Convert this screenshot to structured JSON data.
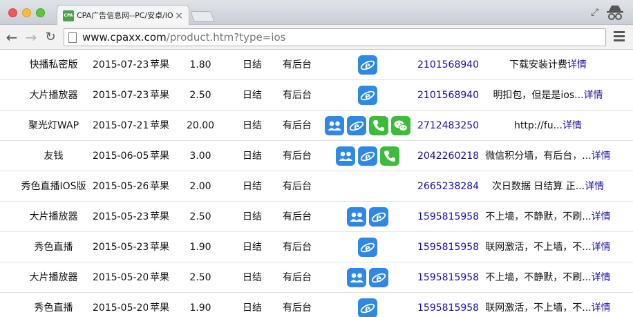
{
  "browser": {
    "tab_title": "CPA广告信息网--PC/安卓/IOS",
    "tab_favicon_text": "CPA",
    "url_host": "www.cpaxx.com",
    "url_path": "/product.htm?type=ios"
  },
  "table": {
    "rows": [
      {
        "name": "快播私密版",
        "date": "2015-07-23",
        "platform": "苹果",
        "price": "1.80",
        "settle": "日结",
        "backend": "有后台",
        "icons": [
          "ie"
        ],
        "qq": "2101568940",
        "desc": "下载安装计费",
        "detail": "详情"
      },
      {
        "name": "大片播放器",
        "date": "2015-07-23",
        "platform": "苹果",
        "price": "2.50",
        "settle": "日结",
        "backend": "有后台",
        "icons": [
          "ie"
        ],
        "qq": "2101568940",
        "desc": "明扣包，但是是ios...",
        "detail": "详情"
      },
      {
        "name": "聚光灯WAP",
        "date": "2015-07-21",
        "platform": "苹果",
        "price": "20.00",
        "settle": "日结",
        "backend": "有后台",
        "icons": [
          "group",
          "ie",
          "phone",
          "wechat"
        ],
        "qq": "2712483250",
        "desc": "http://fu...",
        "detail": "详情"
      },
      {
        "name": "友钱",
        "date": "2015-06-05",
        "platform": "苹果",
        "price": "3.00",
        "settle": "日结",
        "backend": "有后台",
        "icons": [
          "group",
          "ie",
          "phone"
        ],
        "qq": "2042260218",
        "desc": "微信积分墙，有后台，...",
        "detail": "详情"
      },
      {
        "name": "秀色直播IOS版",
        "date": "2015-05-26",
        "platform": "苹果",
        "price": "2.00",
        "settle": "日结",
        "backend": "有后台",
        "icons": [],
        "qq": "2665238284",
        "desc": "次日数据 日结算 正...",
        "detail": "详情"
      },
      {
        "name": "大片播放器",
        "date": "2015-05-23",
        "platform": "苹果",
        "price": "2.50",
        "settle": "日结",
        "backend": "有后台",
        "icons": [
          "group",
          "ie"
        ],
        "qq": "1595815958",
        "desc": "不上墙，不静默，不刷...",
        "detail": "详情"
      },
      {
        "name": "秀色直播",
        "date": "2015-05-23",
        "platform": "苹果",
        "price": "1.90",
        "settle": "日结",
        "backend": "有后台",
        "icons": [
          "ie"
        ],
        "qq": "1595815958",
        "desc": "联网激活，不上墙，不...",
        "detail": "详情"
      },
      {
        "name": "大片播放器",
        "date": "2015-05-20",
        "platform": "苹果",
        "price": "2.50",
        "settle": "日结",
        "backend": "有后台",
        "icons": [
          "group",
          "ie"
        ],
        "qq": "1595815958",
        "desc": "不上墙，不静默，不刷...",
        "detail": "详情"
      },
      {
        "name": "秀色直播",
        "date": "2015-05-20",
        "platform": "苹果",
        "price": "1.90",
        "settle": "日结",
        "backend": "有后台",
        "icons": [
          "ie"
        ],
        "qq": "1595815958",
        "desc": "联网激活，不上墙，不...",
        "detail": "详情"
      }
    ]
  }
}
